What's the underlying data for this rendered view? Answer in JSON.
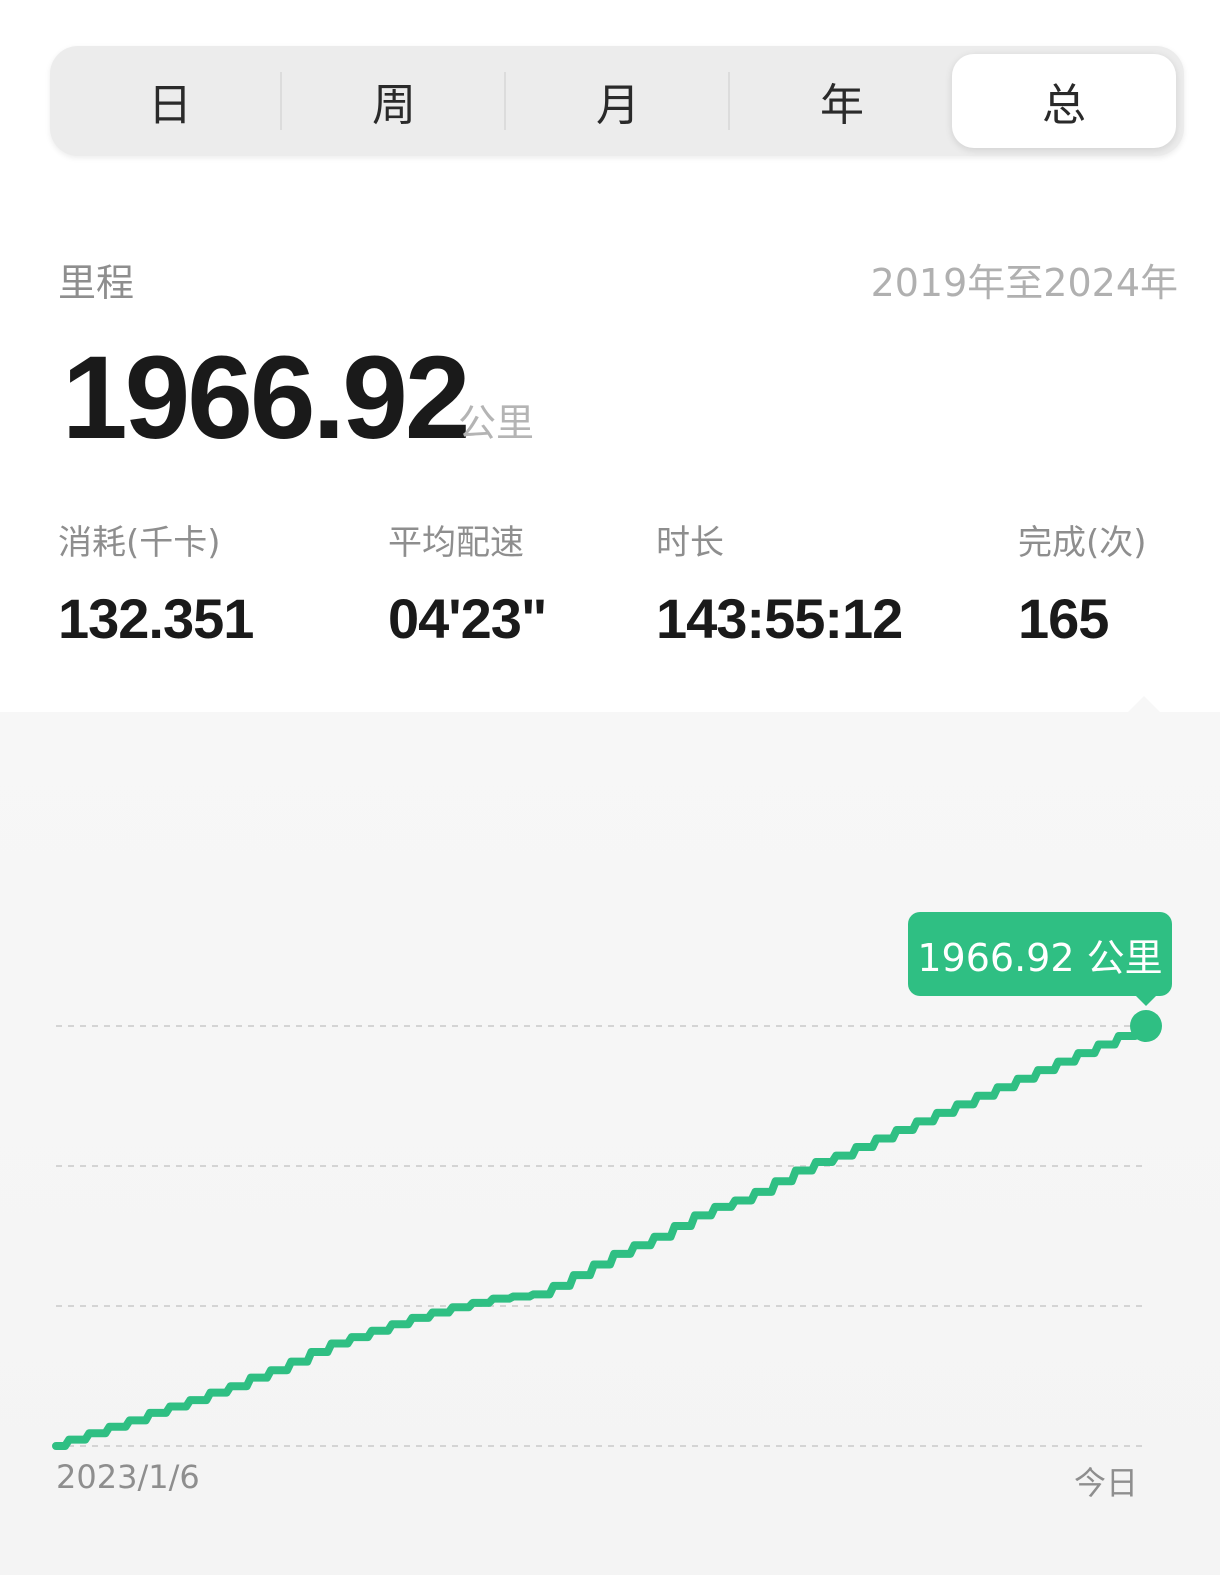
{
  "tabs": [
    "日",
    "周",
    "月",
    "年",
    "总"
  ],
  "active_tab": 4,
  "summary": {
    "label": "里程",
    "date_range": "2019年至2024年",
    "distance_value": "1966.92",
    "distance_unit": "公里"
  },
  "stats": [
    {
      "label": "消耗(千卡)",
      "value": "132.351"
    },
    {
      "label": "平均配速",
      "value": "04'23\""
    },
    {
      "label": "时长",
      "value": "143:55:12"
    },
    {
      "label": "完成(次)",
      "value": "165"
    }
  ],
  "colors": {
    "accent": "#2fbf83",
    "grid": "#d4d4d4"
  },
  "chart_data": {
    "type": "line",
    "title": "",
    "xlabel": "",
    "ylabel": "",
    "x_tick_labels": [
      "2023/1/6",
      "今日"
    ],
    "tooltip": "1966.92 公里",
    "grid": "horizontal-dashed",
    "y_max": 1966.92,
    "series": [
      {
        "values": [
          0,
          30,
          60,
          90,
          120,
          155,
          185,
          215,
          250,
          280,
          320,
          355,
          395,
          440,
          480,
          510,
          540,
          570,
          600,
          625,
          650,
          670,
          690,
          700,
          710,
          750,
          800,
          850,
          900,
          940,
          980,
          1030,
          1080,
          1120,
          1150,
          1190,
          1240,
          1290,
          1330,
          1360,
          1400,
          1440,
          1480,
          1520,
          1560,
          1600,
          1640,
          1680,
          1720,
          1760,
          1800,
          1840,
          1880,
          1920,
          1966.92
        ]
      }
    ]
  }
}
